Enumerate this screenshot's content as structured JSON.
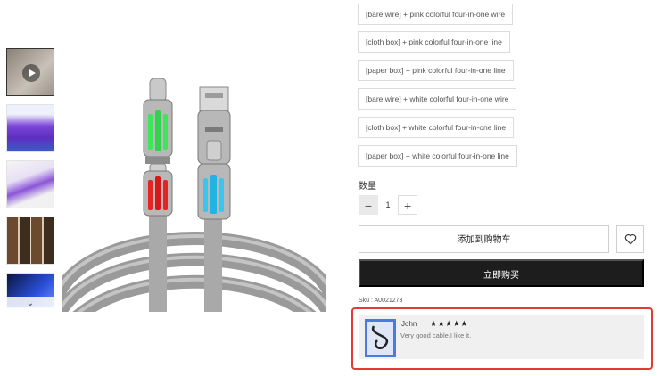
{
  "gallery": {
    "thumbnails": [
      {
        "label": "video-thumbnail",
        "active": true
      },
      {
        "label": "purple-cable-thumbnail"
      },
      {
        "label": "cable-closeup-thumbnail"
      },
      {
        "label": "packaging-thumbnail"
      },
      {
        "label": "blue-light-thumbnail"
      }
    ],
    "scroll_down_icon": "chevron-down-icon"
  },
  "product": {
    "variants": [
      "[bare wire] + pink colorful four-in-one wire",
      "[cloth box] + pink colorful four-in-one line",
      "[paper box] + pink colorful four-in-one line",
      "[bare wire] + white colorful four-in-one wire",
      "[cloth box] + white colorful four-in-one line",
      "[paper box] + white colorful four-in-one line"
    ],
    "quantity_label": "数量",
    "quantity": "1",
    "minus": "−",
    "plus": "+",
    "add_to_cart": "添加到购物车",
    "buy_now": "立即购买",
    "sku": "Sku : A0021273"
  },
  "review": {
    "name": "John",
    "stars": "★★★★★",
    "rating": 5,
    "text": "Very good cable.I like it."
  },
  "colors": {
    "buy_button": "#1d1d1d",
    "highlight_outline": "#e53935",
    "review_bg": "#f0f0f0"
  }
}
